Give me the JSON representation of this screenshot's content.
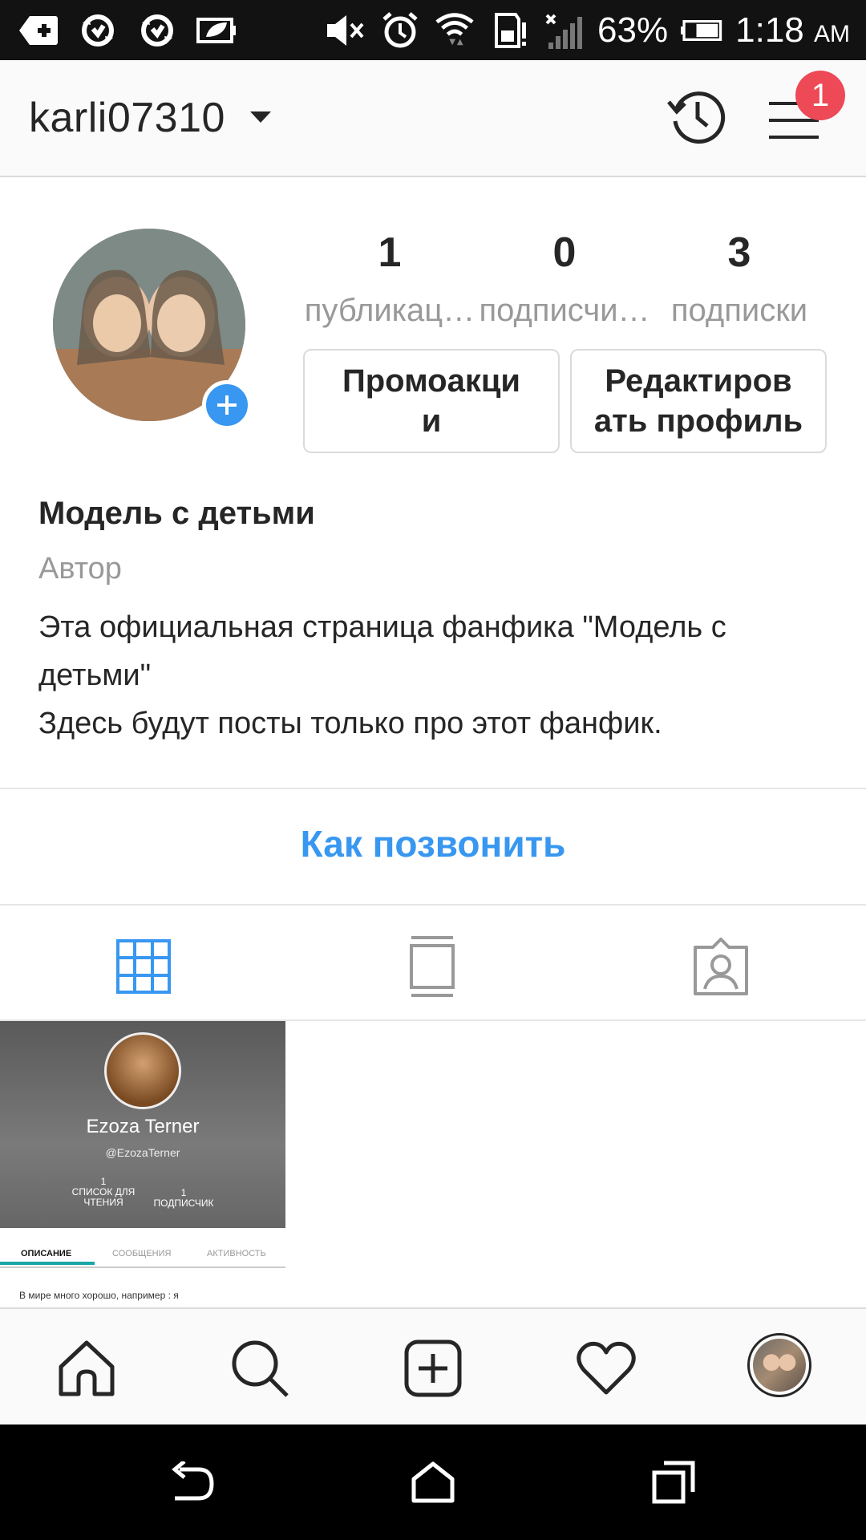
{
  "status_bar": {
    "battery_percent": "63%",
    "time": "1:18",
    "ampm": "AM"
  },
  "app_bar": {
    "username": "karli07310",
    "notification_count": "1"
  },
  "profile": {
    "stats": [
      {
        "value": "1",
        "label": "публикац…"
      },
      {
        "value": "0",
        "label": "подписчи…"
      },
      {
        "value": "3",
        "label": "подписки"
      }
    ],
    "buttons": {
      "promo_line1": "Промоакци",
      "promo_line2": "и",
      "edit_line1": "Редактиров",
      "edit_line2": "ать профиль"
    },
    "bio": {
      "name": "Модель с детьми",
      "category": "Автор",
      "line1": "Эта официальная страница фанфика \"Модель с",
      "line2": "детьми\"",
      "line3": "Здесь будут посты только про этот фанфик."
    },
    "call_link": "Как позвонить"
  },
  "post": {
    "name": "Ezoza Terner",
    "handle": "@EzozaTerner",
    "stat1_value": "1",
    "stat1_label_a": "СПИСОК ДЛЯ",
    "stat1_label_b": "ЧТЕНИЯ",
    "stat2_value": "1",
    "stat2_label": "ПОДПИСЧИК",
    "tab1": "ОПИСАНИЕ",
    "tab2": "СООБЩЕНИЯ",
    "tab3": "АКТИВНОСТЬ",
    "desc": "В мире много хорошо, например : я"
  },
  "colors": {
    "accent": "#3897f0",
    "badge": "#ed4956",
    "muted": "#999999"
  }
}
